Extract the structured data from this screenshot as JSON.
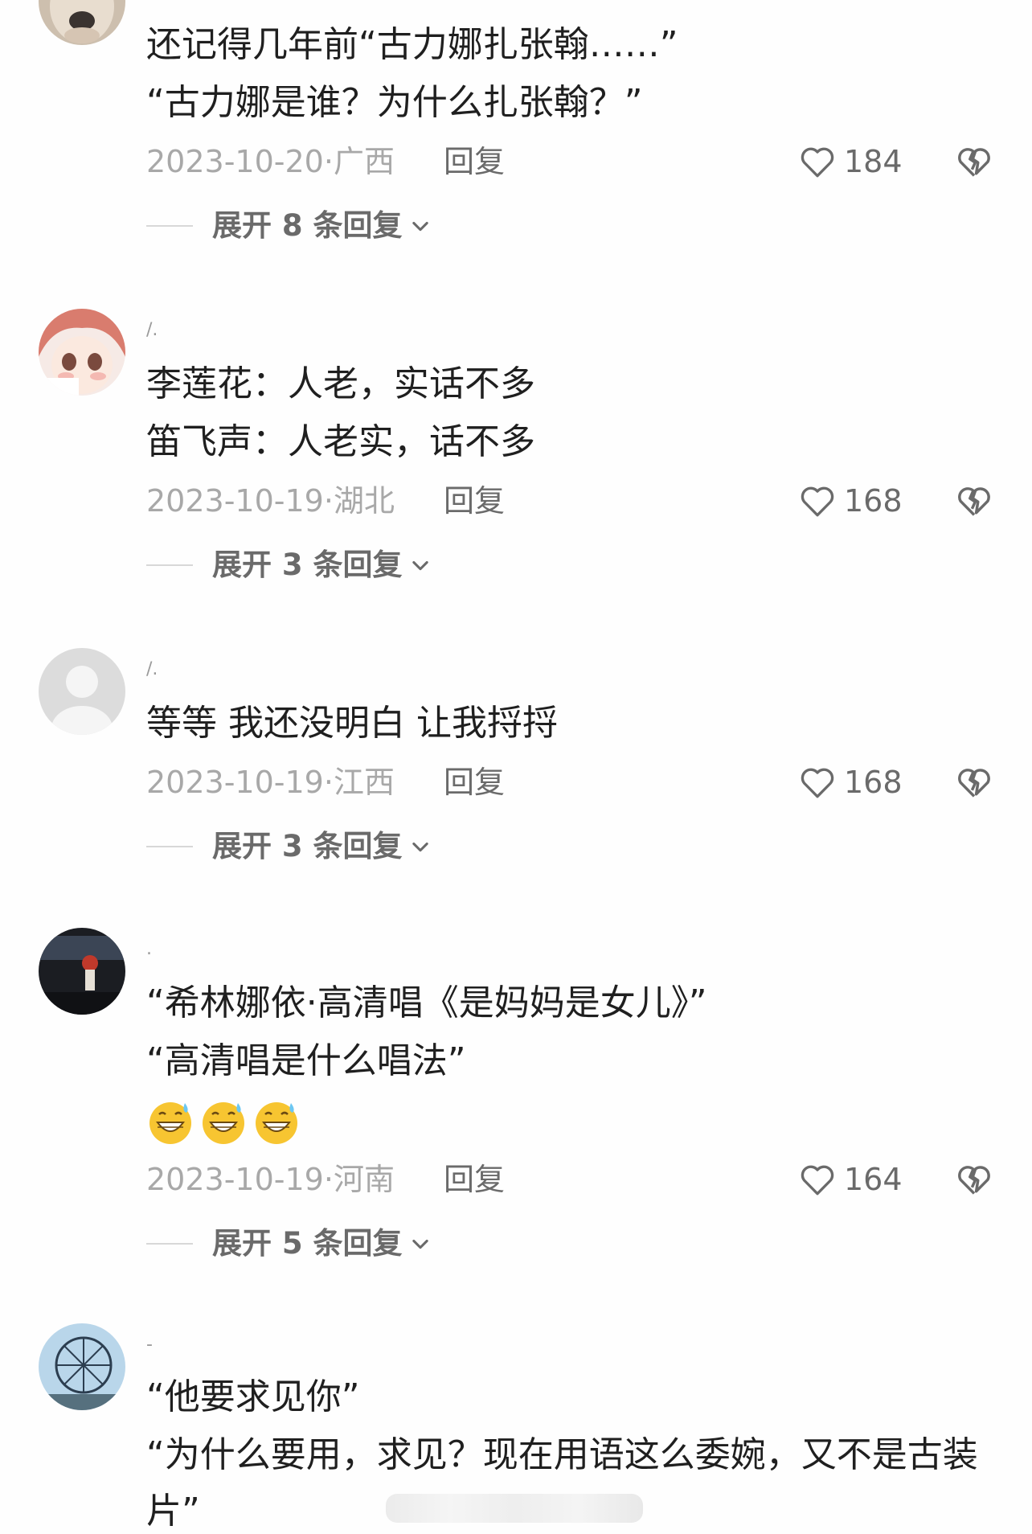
{
  "comments": [
    {
      "username": "",
      "lines": [
        "还记得几年前“古力娜扎张翰……”",
        "“古力娜是谁？为什么扎张翰？”"
      ],
      "date": "2023-10-20",
      "location": "广西",
      "reply_label": "回复",
      "likes": "184",
      "expand_label": "展开 8 条回复"
    },
    {
      "username": "/.",
      "lines": [
        "李莲花：人老，实话不多",
        "笛飞声：人老实，话不多"
      ],
      "date": "2023-10-19",
      "location": "湖北",
      "reply_label": "回复",
      "likes": "168",
      "expand_label": "展开 3 条回复"
    },
    {
      "username": "/.",
      "lines": [
        "等等 我还没明白 让我捋捋"
      ],
      "date": "2023-10-19",
      "location": "江西",
      "reply_label": "回复",
      "likes": "168",
      "expand_label": "展开 3 条回复"
    },
    {
      "username": ".",
      "lines": [
        "“希林娜依·高清唱《是妈妈是女儿》”",
        "“高清唱是什么唱法”"
      ],
      "emojis": [
        "grin-sweat-emoji",
        "grin-sweat-emoji",
        "grin-sweat-emoji"
      ],
      "date": "2023-10-19",
      "location": "河南",
      "reply_label": "回复",
      "likes": "164",
      "expand_label": "展开 5 条回复"
    },
    {
      "username": "-",
      "lines": [
        "“他要求见你”",
        "“为什么要用，求见？现在用语这么委婉，又不是古装",
        "片”"
      ]
    }
  ],
  "icons": {
    "like": "heart-outline-icon",
    "dislike": "broken-heart-icon",
    "expand": "chevron-down-icon"
  },
  "colors": {
    "text": "#1f1f1f",
    "meta": "#a8a8a8",
    "action": "#6a6a6a"
  }
}
